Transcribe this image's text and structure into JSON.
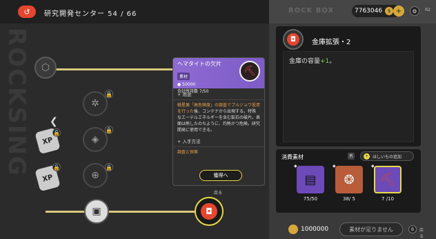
{
  "header": {
    "title": "研究開発センター 54 / 66",
    "back_icon": "back-arrow-icon"
  },
  "tooltip": {
    "item_name": "ヘマタイトの欠片",
    "category": "素材",
    "price": "50000",
    "owned": "合計所持数 7/50",
    "section_usage": "+ 用途",
    "usage_text_hl": "戦星屑「高危険度」の調査でブルジョワ投資を行った",
    "usage_text": "後、コンテナから出現する。特殊なエーテルエネルギーを含む鉱石の破片。表面は熱したのちように、灼熱かつ危険。研究開発に使用できる。",
    "section_obtain": "+ 入手方法",
    "obtain_link": "調査と探索",
    "button": "獲得へ",
    "return_label": "戻る"
  },
  "topbar": {
    "brand": "ROCK BOX",
    "money": "7763046",
    "r_label": "R2"
  },
  "detail": {
    "title": "金庫拡張・2",
    "desc_prefix": "金庫の容量",
    "desc_plus": "+1",
    "desc_suffix": "。"
  },
  "consumables": {
    "title": "消費素材",
    "info": "R",
    "wishlist": "ほしいもの追加",
    "materials": [
      {
        "count": "75/50"
      },
      {
        "count": "38/ 5"
      },
      {
        "count": "7 /10"
      }
    ]
  },
  "bottom": {
    "cost": "1000000",
    "button": "素材が足りません",
    "r_label": "戻る"
  },
  "colors": {
    "accent_yellow": "#e8d94a",
    "accent_red": "#e5462e",
    "purple": "#8e6bd3",
    "gold": "#d6a83a"
  }
}
